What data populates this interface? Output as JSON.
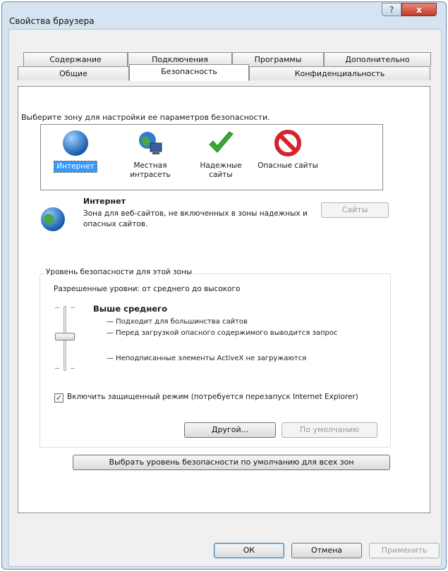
{
  "window": {
    "title": "Свойства браузера",
    "help_label": "?",
    "close_label": "x"
  },
  "tabs": {
    "row1": [
      {
        "label": "Содержание"
      },
      {
        "label": "Подключения"
      },
      {
        "label": "Программы"
      },
      {
        "label": "Дополнительно"
      }
    ],
    "row2": [
      {
        "label": "Общие"
      },
      {
        "label": "Безопасность",
        "active": true
      },
      {
        "label": "Конфиденциальность"
      }
    ]
  },
  "zones": {
    "prompt": "Выберите зону для настройки ее параметров безопасности.",
    "items": [
      {
        "label": "Интернет",
        "icon": "globe-icon",
        "selected": true
      },
      {
        "label": "Местная интрасеть",
        "icon": "intranet-icon"
      },
      {
        "label": "Надежные сайты",
        "icon": "checkmark-icon"
      },
      {
        "label": "Опасные сайты",
        "icon": "prohibited-icon"
      }
    ]
  },
  "zone_info": {
    "title": "Интернет",
    "description": "Зона для веб-сайтов, не включенных в зоны надежных и опасных сайтов.",
    "sites_button": "Сайты"
  },
  "security_level": {
    "caption": "Уровень безопасности для этой зоны",
    "allowed_levels": "Разрешенные уровни: от среднего до высокого",
    "level_name": "Выше среднего",
    "bullets": [
      "— Подходит для большинства сайтов",
      "— Перед загрузкой опасного содержимого выводится запрос",
      "— Неподписанные элементы ActiveX не загружаются"
    ],
    "protected_mode_label": "Включить защищенный режим (потребуется перезапуск Internet Explorer)",
    "protected_mode_checked": true,
    "custom_button": "Другой...",
    "default_button": "По умолчанию",
    "reset_all_button": "Выбрать уровень безопасности по умолчанию для всех зон"
  },
  "footer": {
    "ok": "ОК",
    "cancel": "Отмена",
    "apply": "Применить"
  },
  "colors": {
    "selection": "#3399ff",
    "window_frame": "#d6e3f1",
    "close_button": "#c0392b"
  }
}
